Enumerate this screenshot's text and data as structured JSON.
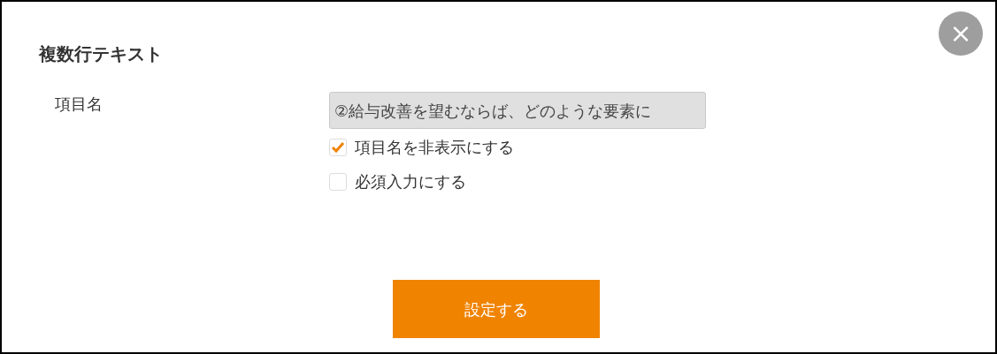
{
  "dialog": {
    "title": "複数行テキスト",
    "close_label": "×"
  },
  "field": {
    "label": "項目名",
    "value": "②給与改善を望むならば、どのような要素に",
    "disabled": true
  },
  "options": [
    {
      "label": "項目名を非表示にする",
      "checked": true
    },
    {
      "label": "必須入力にする",
      "checked": false
    }
  ],
  "submit": "設定する"
}
